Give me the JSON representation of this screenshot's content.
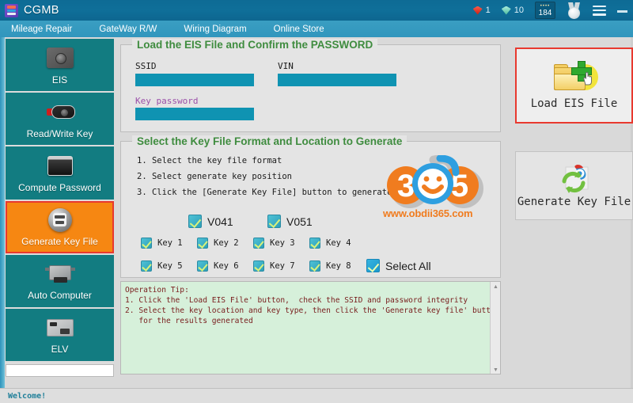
{
  "window": {
    "title": "CGMB",
    "logo_icon": "cgmb-logo-icon",
    "minimize_label": "minimize-icon",
    "menu_icon": "hamburger-menu-icon"
  },
  "titlebar_stats": {
    "red_gem_icon": "red-diamond-icon",
    "red_gem_count": "1",
    "green_gem_icon": "green-diamond-icon",
    "green_gem_count": "10",
    "points_badge_dots": "••••",
    "points_badge_value": "184",
    "medal_icon": "medal-icon"
  },
  "menubar": {
    "items": [
      {
        "label": "Mileage Repair",
        "name": "menu-mileage-repair"
      },
      {
        "label": "GateWay R/W",
        "name": "menu-gateway-rw"
      },
      {
        "label": "Wiring Diagram",
        "name": "menu-wiring-diagram"
      },
      {
        "label": "Online Store",
        "name": "menu-online-store"
      }
    ]
  },
  "sidebar": {
    "items": [
      {
        "label": "EIS",
        "icon": "eis-module-icon",
        "active": false
      },
      {
        "label": "Read/Write Key",
        "icon": "car-key-icon",
        "active": false
      },
      {
        "label": "Compute Password",
        "icon": "password-device-icon",
        "active": false
      },
      {
        "label": "Generate Key File",
        "icon": "key-file-disc-icon",
        "active": true
      },
      {
        "label": "Auto Computer",
        "icon": "ecu-module-icon",
        "active": false
      },
      {
        "label": "ELV",
        "icon": "elv-board-icon",
        "active": false
      }
    ],
    "status_field_value": ""
  },
  "panel_load": {
    "title": "Load the EIS File and Confirm the PASSWORD",
    "ssid_label": "SSID",
    "ssid_value": "",
    "ssid_placeholder": "",
    "vin_label": "VIN",
    "vin_value": "",
    "vin_placeholder": "",
    "key_password_label": "Key password",
    "key_password_value": "",
    "key_password_placeholder": ""
  },
  "panel_select": {
    "title": "Select the Key File Format and Location to Generate",
    "steps": [
      "1. Select the key file format",
      "2. Select generate key position",
      "3. Click the [Generate Key File] button to generate"
    ],
    "formats": [
      {
        "label": "V041",
        "checked": true
      },
      {
        "label": "V051",
        "checked": true
      }
    ],
    "keys": [
      {
        "label": "Key 1",
        "checked": true
      },
      {
        "label": "Key 2",
        "checked": true
      },
      {
        "label": "Key 3",
        "checked": true
      },
      {
        "label": "Key 4",
        "checked": true
      },
      {
        "label": "Key 5",
        "checked": true
      },
      {
        "label": "Key 6",
        "checked": true
      },
      {
        "label": "Key 7",
        "checked": true
      },
      {
        "label": "Key 8",
        "checked": true
      }
    ],
    "select_all": {
      "label": "Select All",
      "checked": true
    }
  },
  "watermark": {
    "digits_left": "3",
    "digits_right": "5",
    "url": "www.obdii365.com"
  },
  "tip": {
    "text": "Operation Tip:\n1. Click the 'Load EIS File' button,  check the SSID and password integrity\n2. Select the key location and key type, then click the 'Generate key file' button, waiting\n   for the results generated",
    "scroll_up_icon": "scroll-up-arrow-icon",
    "scroll_down_icon": "scroll-down-arrow-icon"
  },
  "action_buttons": [
    {
      "label": "Load EIS File",
      "icon": "folder-add-icon",
      "highlighted": true,
      "name": "load-eis-file-button"
    },
    {
      "label": "Generate Key File",
      "icon": "sync-generate-icon",
      "highlighted": false,
      "name": "generate-key-file-button"
    }
  ],
  "statusbar": {
    "message": "Welcome!"
  },
  "colors": {
    "titlebar": "#0f6f99",
    "menubar": "#3196bd",
    "sidebar_teal": "#127c81",
    "sidebar_active_orange": "#f68712",
    "highlight_red": "#e8392f",
    "input_teal": "#0f93b2",
    "panel_title_green": "#3f8c3f",
    "tip_bg_green": "#d6f0da",
    "tip_text_red": "#7a2020",
    "status_text_teal": "#1f7f99",
    "watermark_orange": "#f07c1f"
  }
}
